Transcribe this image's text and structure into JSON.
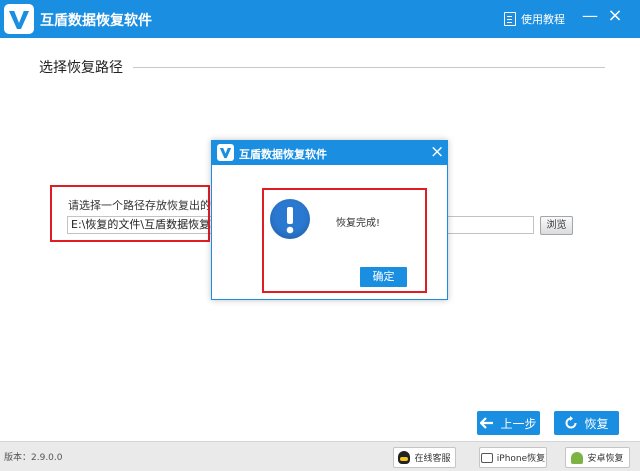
{
  "app": {
    "title": "互盾数据恢复软件",
    "help_label": "使用教程",
    "minimize_glyph": "—",
    "close_glyph": "×",
    "accent_color": "#1a8ee1"
  },
  "main": {
    "section_title": "选择恢复路径",
    "path_label": "请选择一个路径存放恢复出的文件",
    "path_value": "E:\\恢复的文件\\互盾数据恢复软件",
    "browse_label": "浏览",
    "back_label": "上一步",
    "recover_label": "恢复"
  },
  "footer": {
    "version": "版本：2.9.0.0",
    "service_label": "在线客服",
    "iphone_label": "iPhone恢复",
    "android_label": "安卓恢复"
  },
  "dialog": {
    "title": "互盾数据恢复软件",
    "close_glyph": "×",
    "message": "恢复完成!",
    "ok_label": "确定",
    "icon": "exclamation-icon"
  },
  "highlight_color": "#e11d24"
}
